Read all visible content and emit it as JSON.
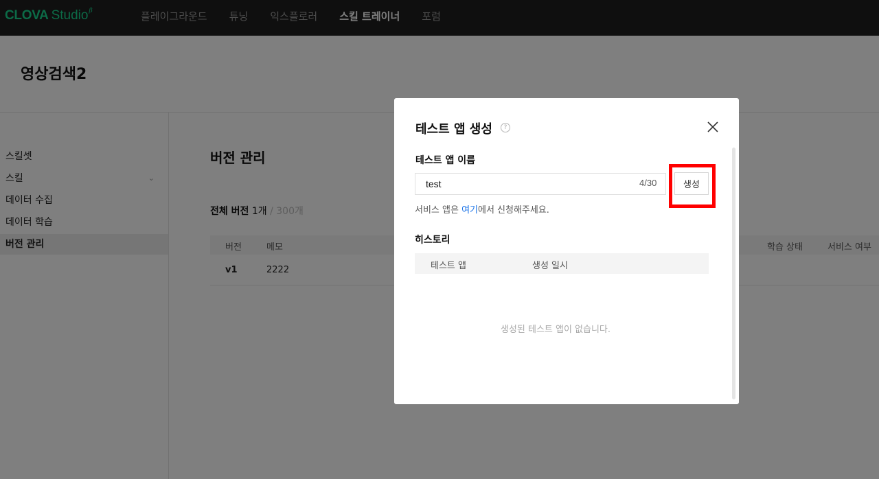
{
  "app": {
    "logo_main": "CLOVA",
    "logo_sub": "Studio",
    "logo_beta": "β"
  },
  "nav": {
    "items": [
      {
        "label": "플레이그라운드",
        "active": false
      },
      {
        "label": "튜닝",
        "active": false
      },
      {
        "label": "익스플로러",
        "active": false
      },
      {
        "label": "스킬 트레이너",
        "active": true
      },
      {
        "label": "포럼",
        "active": false
      }
    ]
  },
  "page": {
    "title": "영상검색2"
  },
  "sidebar": {
    "items": [
      {
        "label": "스킬셋"
      },
      {
        "label": "스킬"
      },
      {
        "label": "데이터 수집"
      },
      {
        "label": "데이터 학습"
      },
      {
        "label": "버전 관리"
      }
    ],
    "chevron": "⌄"
  },
  "main": {
    "section_title": "버전 관리",
    "count_label": "전체 버전",
    "count_value": "1개",
    "count_max": "/ 300개",
    "columns": [
      "버전",
      "메모",
      "학습 상태",
      "서비스 여부"
    ],
    "rows": [
      {
        "version": "v1",
        "memo": "2222"
      }
    ]
  },
  "modal": {
    "title": "테스트 앱 생성",
    "help_glyph": "?",
    "name_label": "테스트 앱 이름",
    "name_value": "test",
    "char_count": "4/30",
    "create_button": "생성",
    "hint_prefix": "서비스 앱은 ",
    "hint_link": "여기",
    "hint_suffix": "에서 신청해주세요.",
    "history_label": "히스토리",
    "history_columns": [
      "테스트 앱",
      "생성 일시"
    ],
    "empty_message": "생성된 테스트 앱이 없습니다."
  },
  "colors": {
    "brand": "#18d68f",
    "link": "#1a73e8",
    "highlight": "#ff0000"
  }
}
